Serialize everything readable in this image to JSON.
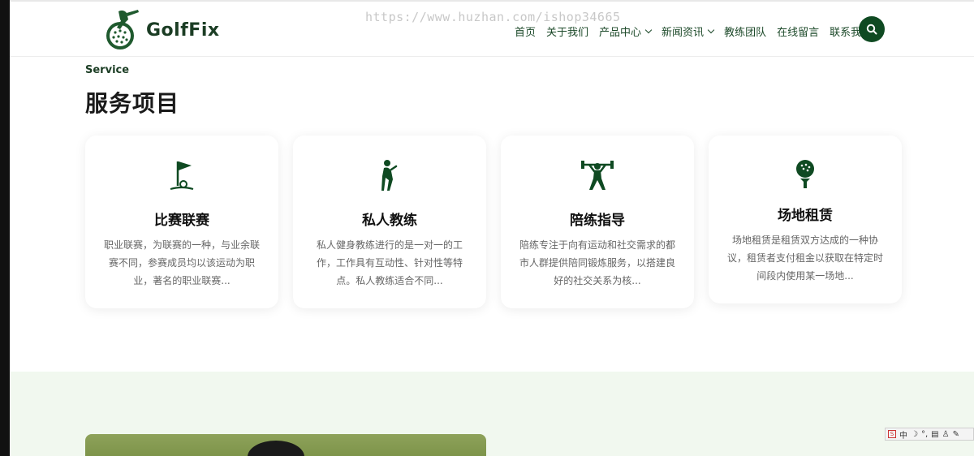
{
  "header": {
    "logo_text": "GolfFix",
    "watermark": "https://www.huzhan.com/ishop34665",
    "nav": [
      {
        "label": "首页",
        "has_dropdown": false
      },
      {
        "label": "关于我们",
        "has_dropdown": false
      },
      {
        "label": "产品中心",
        "has_dropdown": true
      },
      {
        "label": "新闻资讯",
        "has_dropdown": true
      },
      {
        "label": "教练团队",
        "has_dropdown": false
      },
      {
        "label": "在线留言",
        "has_dropdown": false
      },
      {
        "label": "联系我们",
        "has_dropdown": false
      }
    ],
    "search_icon": "search-icon"
  },
  "services": {
    "eyebrow": "Service",
    "title": "服务项目",
    "cards": [
      {
        "icon": "golf-flag-icon",
        "title": "比赛联赛",
        "desc": "职业联赛，为联赛的一种，与业余联赛不同，参赛成员均以该运动为职业，著名的职业联赛..."
      },
      {
        "icon": "golfer-icon",
        "title": "私人教练",
        "desc": "私人健身教练进行的是一对一的工作，工作具有互动性、针对性等特点。私人教练适合不同..."
      },
      {
        "icon": "weightlifter-icon",
        "title": "陪练指导",
        "desc": "陪练专注于向有运动和社交需求的都市人群提供陪同锻炼服务，以搭建良好的社交关系为核..."
      },
      {
        "icon": "golf-ball-tee-icon",
        "title": "场地租赁",
        "desc": "场地租赁是租赁双方达成的一种协议，租赁者支付租金以获取在特定时间段内使用某一场地..."
      }
    ]
  },
  "ime_toolbar": {
    "lang": "中"
  },
  "colors": {
    "brand_green": "#0f4a22",
    "band_bg": "#f1f8ef"
  }
}
